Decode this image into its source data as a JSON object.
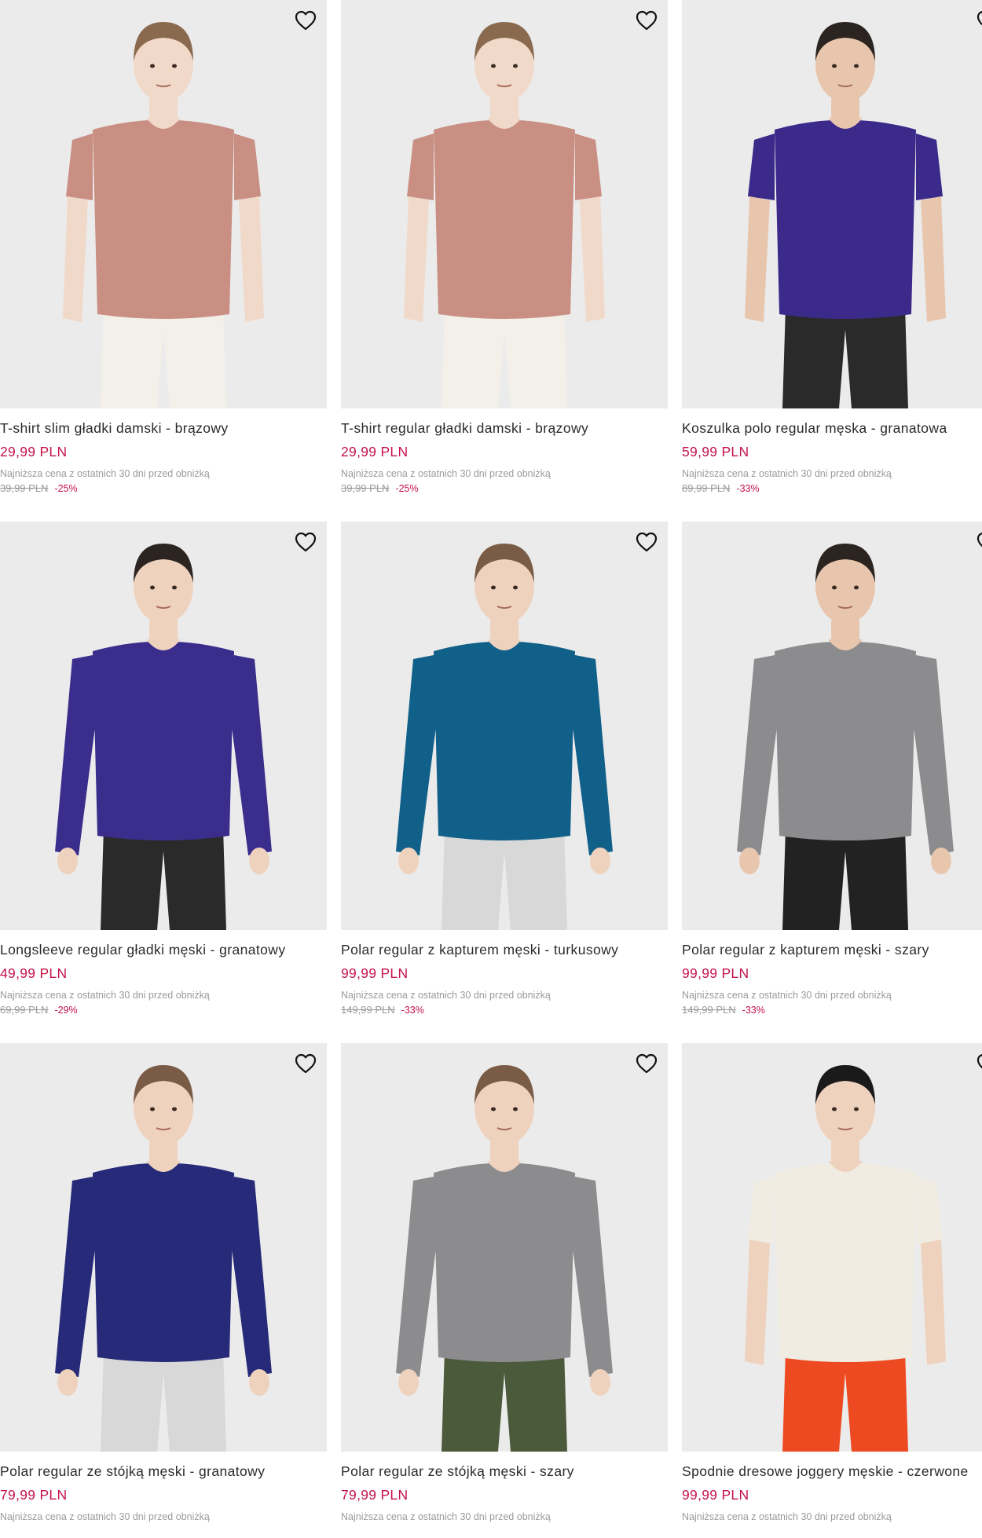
{
  "wishlist_icon": "heart-outline-icon",
  "products": [
    {
      "title": "T-shirt slim gładki damski - brązowy",
      "price": "29,99 PLN",
      "lowest_label": "Najniższa cena z ostatnich 30 dni przed obniżką",
      "old_price": "39,99 PLN",
      "discount": "-25%",
      "top_color": "#c98f83",
      "bottom_color": "#f3f0ea",
      "skin": "#f1d9c9",
      "hair": "#8a6a4e",
      "sleeve": "short"
    },
    {
      "title": "T-shirt regular gładki damski - brązowy",
      "price": "29,99 PLN",
      "lowest_label": "Najniższa cena z ostatnich 30 dni przed obniżką",
      "old_price": "39,99 PLN",
      "discount": "-25%",
      "top_color": "#c98f83",
      "bottom_color": "#f3f0ea",
      "skin": "#f1d9c9",
      "hair": "#8a6a4e",
      "sleeve": "short"
    },
    {
      "title": "Koszulka polo regular męska - granatowa",
      "price": "59,99 PLN",
      "lowest_label": "Najniższa cena z ostatnich 30 dni przed obniżką",
      "old_price": "89,99 PLN",
      "discount": "-33%",
      "top_color": "#3b2a8a",
      "bottom_color": "#2a2a2a",
      "skin": "#e8c6ad",
      "hair": "#2b2420",
      "sleeve": "short"
    },
    {
      "title": "Longsleeve regular gładki męski - granatowy",
      "price": "49,99 PLN",
      "lowest_label": "Najniższa cena z ostatnich 30 dni przed obniżką",
      "old_price": "69,99 PLN",
      "discount": "-29%",
      "top_color": "#3a2d8c",
      "bottom_color": "#2a2a2a",
      "skin": "#efd2bd",
      "hair": "#2b2420",
      "sleeve": "long"
    },
    {
      "title": "Polar regular z kapturem męski - turkusowy",
      "price": "99,99 PLN",
      "lowest_label": "Najniższa cena z ostatnich 30 dni przed obniżką",
      "old_price": "149,99 PLN",
      "discount": "-33%",
      "top_color": "#11608a",
      "bottom_color": "#d8d8d8",
      "skin": "#efd2bd",
      "hair": "#7a5c46",
      "sleeve": "long"
    },
    {
      "title": "Polar regular z kapturem męski - szary",
      "price": "99,99 PLN",
      "lowest_label": "Najniższa cena z ostatnich 30 dni przed obniżką",
      "old_price": "149,99 PLN",
      "discount": "-33%",
      "top_color": "#8c8c8e",
      "bottom_color": "#222222",
      "skin": "#e8c6ad",
      "hair": "#2b2420",
      "sleeve": "long"
    },
    {
      "title": "Polar regular ze stójką męski - granatowy",
      "price": "79,99 PLN",
      "lowest_label": "Najniższa cena z ostatnich 30 dni przed obniżką",
      "old_price": "",
      "discount": "",
      "top_color": "#262a78",
      "bottom_color": "#d8d8d8",
      "skin": "#efd2bd",
      "hair": "#7a5c46",
      "sleeve": "long"
    },
    {
      "title": "Polar regular ze stójką męski - szary",
      "price": "79,99 PLN",
      "lowest_label": "Najniższa cena z ostatnich 30 dni przed obniżką",
      "old_price": "",
      "discount": "",
      "top_color": "#8c8c8e",
      "bottom_color": "#4a5a3a",
      "skin": "#efd2bd",
      "hair": "#7a5c46",
      "sleeve": "long"
    },
    {
      "title": "Spodnie dresowe joggery męskie - czerwone",
      "price": "99,99 PLN",
      "lowest_label": "Najniższa cena z ostatnich 30 dni przed obniżką",
      "old_price": "",
      "discount": "",
      "top_color": "#f0ece2",
      "bottom_color": "#ee4a22",
      "skin": "#efd2bd",
      "hair": "#1a1a1a",
      "sleeve": "short"
    }
  ]
}
